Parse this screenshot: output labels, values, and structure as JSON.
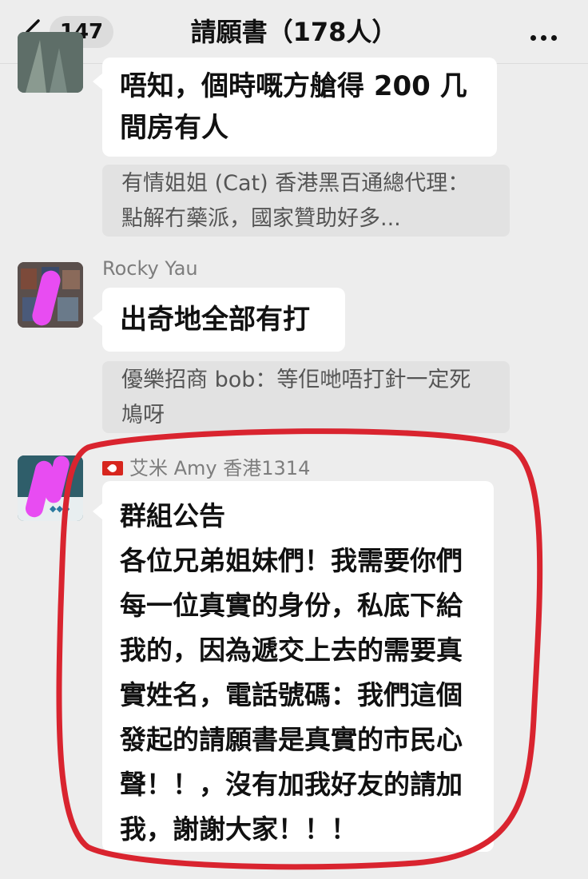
{
  "header": {
    "back_count": "147",
    "title": "請願書（178人）"
  },
  "messages": [
    {
      "text": "唔知，個時嘅方艙得 200 几間房有人"
    },
    {
      "sender": "Rocky Yau",
      "text": "出奇地全部有打"
    },
    {
      "sender": "艾米 Amy 香港1314",
      "text": "群組公告\n各位兄弟姐妹們！我需要你們每一位真實的身份，私底下給我的，因為遞交上去的需要真實姓名，電話號碼：我們這個發起的請願書是真實的市民心聲！！，沒有加我好友的請加我，謝謝大家！！！"
    }
  ],
  "quotes": [
    {
      "text": "有情姐姐 (Cat) 香港黑百通總代理：點解冇藥派，國家贊助好多..."
    },
    {
      "text": "優樂招商 bob：等佢哋唔打針一定死鳩呀"
    }
  ],
  "colors": {
    "annotation_circle": "#d9242f",
    "scribble": "#e84cf2"
  },
  "icons": {
    "back": "chevron-left-icon",
    "more": "more-dots-icon",
    "flag": "hong-kong-flag-icon"
  }
}
